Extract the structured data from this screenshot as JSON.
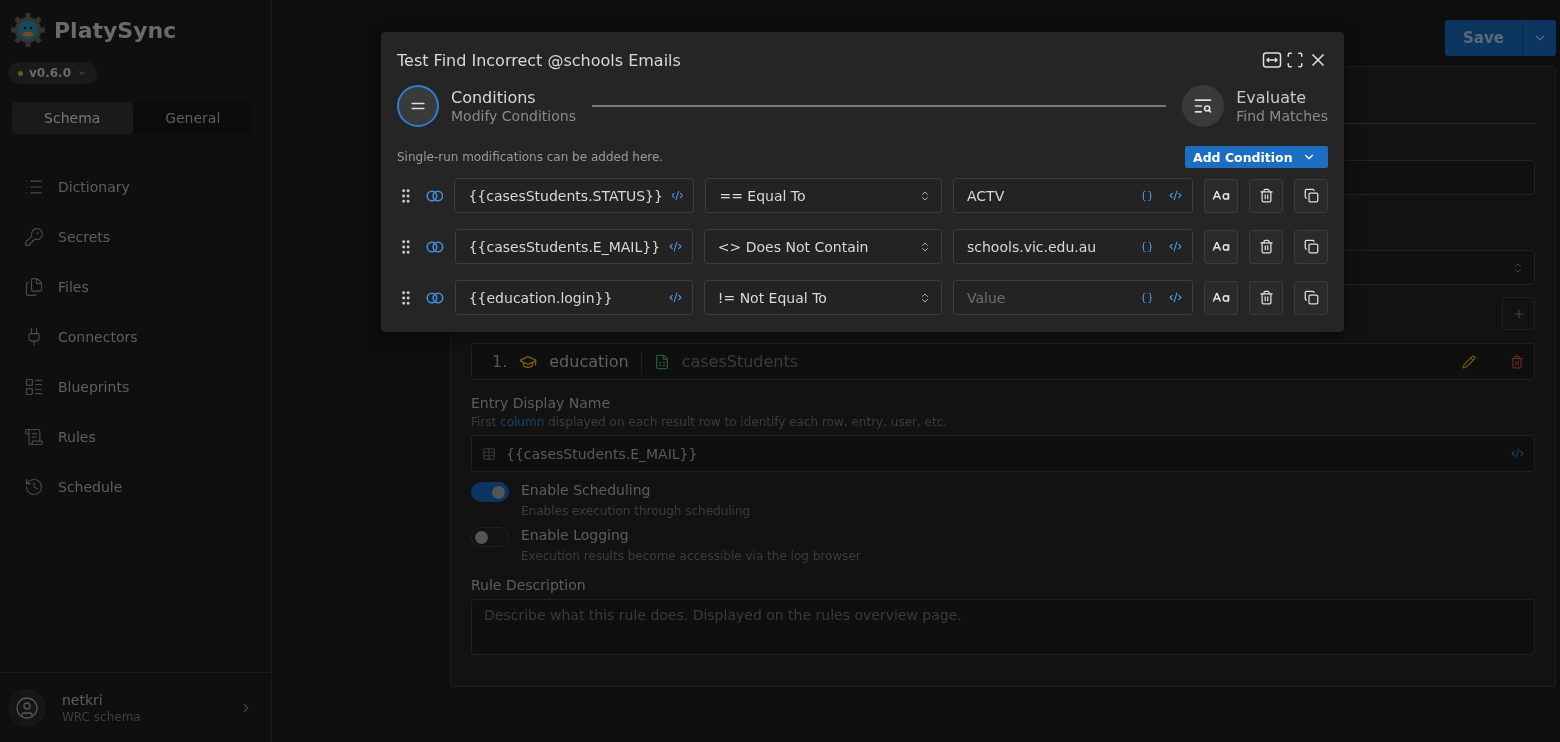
{
  "app": {
    "name": "PlatySync",
    "version": "v0.6.0"
  },
  "sidebar": {
    "tabs": [
      {
        "label": "Schema",
        "selected": true
      },
      {
        "label": "General",
        "selected": false
      }
    ],
    "nav": [
      {
        "label": "Dictionary"
      },
      {
        "label": "Secrets"
      },
      {
        "label": "Files"
      },
      {
        "label": "Connectors"
      },
      {
        "label": "Blueprints"
      },
      {
        "label": "Rules"
      },
      {
        "label": "Schedule"
      }
    ],
    "user": {
      "name": "netkri",
      "schema": "WRC schema"
    }
  },
  "page": {
    "save": "Save"
  },
  "card": {
    "source": {
      "index": "1.",
      "name": "education",
      "file": "casesStudents"
    },
    "entry_display": {
      "label": "Entry Display Name",
      "hint_start": "First",
      "hint_link": "column",
      "hint_end": "displayed on each result row to identify each row, entry, user, etc.",
      "value": "{{casesStudents.E_MAIL}}"
    },
    "toggles": [
      {
        "label": "Enable Scheduling",
        "description": "Enables execution through scheduling",
        "on": true
      },
      {
        "label": "Enable Logging",
        "description": "Execution results become accessible via the log browser",
        "on": false
      }
    ],
    "description": {
      "label": "Rule Description",
      "placeholder": "Describe what this rule does. Displayed on the rules overview page."
    }
  },
  "modal": {
    "title": "Test Find Incorrect @schools Emails",
    "steps": [
      {
        "title": "Conditions",
        "subtitle": "Modify Conditions",
        "selected": true
      },
      {
        "title": "Evaluate",
        "subtitle": "Find Matches",
        "selected": false
      }
    ],
    "note": "Single-run modifications can be added here.",
    "add_button": "Add Condition",
    "conditions": [
      {
        "field": "{{casesStudents.STATUS}}",
        "operator": "== Equal To",
        "value": "ACTV"
      },
      {
        "field": "{{casesStudents.E_MAIL}}",
        "operator": "<> Does Not Contain",
        "value": "schools.vic.edu.au"
      },
      {
        "field": "{{education.login}}",
        "operator": "!= Not Equal To",
        "placeholder": "Value"
      }
    ]
  }
}
